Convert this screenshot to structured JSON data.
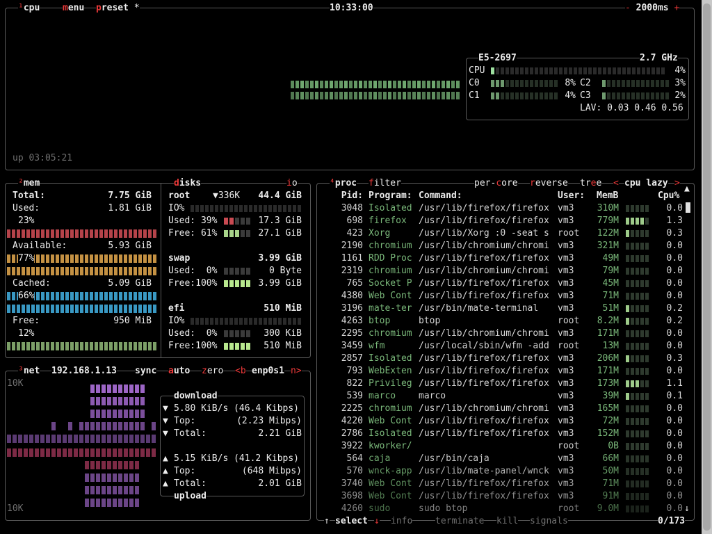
{
  "colors": {
    "background": "#000000",
    "border": "#5a5a5a",
    "accent_red": "#ee3a3a",
    "cpu_green": "#7ab87a",
    "mem_used": "#c94a52",
    "mem_available": "#d9a14a",
    "mem_cached": "#3fa8d8",
    "mem_free": "#8ab072",
    "net_download": "#a46ad0",
    "net_upload": "#c0406a"
  },
  "cpu_box": {
    "tab_num": "¹",
    "tab_label": "cpu",
    "menu_m": "m",
    "menu_rest": "enu",
    "preset_p": "p",
    "preset_rest": "reset",
    "star": "*",
    "clock": "10:33:00",
    "minus": "-",
    "interval": "2000ms",
    "plus": "+",
    "uptime": "up 03:05:21",
    "model": "E5-2697",
    "freq": "2.7 GHz",
    "total_label": "CPU",
    "total_pct": "4%",
    "total_value": 0.04,
    "cores": [
      {
        "name": "C0",
        "pct": "8%",
        "value": 0.08
      },
      {
        "name": "C1",
        "pct": "4%",
        "value": 0.04
      },
      {
        "name": "C2",
        "pct": "3%",
        "value": 0.03
      },
      {
        "name": "C3",
        "pct": "2%",
        "value": 0.02
      }
    ],
    "lav_label": "LAV:",
    "lav": "0.03 0.46 0.56"
  },
  "mem_box": {
    "tab_num": "²",
    "tab_label": "mem",
    "total_label": "Total:",
    "total": "7.75 GiB",
    "used_label": "Used:",
    "used": "1.81 GiB",
    "used_pct": "23%",
    "available_label": "Available:",
    "available": "5.93 GiB",
    "available_pct": "77%",
    "cached_label": "Cached:",
    "cached": "5.09 GiB",
    "cached_pct": "66%",
    "free_label": "Free:",
    "free": "950 MiB",
    "free_pct": "12%"
  },
  "disks_box": {
    "tab_d": "d",
    "tab_rest": "isks",
    "io_i": "i",
    "io_rest": "o",
    "root_label": "root",
    "root_io_speed": "▼336K",
    "root_size": "44.4 GiB",
    "io_label": "IO%",
    "root_used_label": "Used: 39%",
    "root_used": "17.3 GiB",
    "root_free_label": "Free: 61%",
    "root_free": "27.1 GiB",
    "swap_label": "swap",
    "swap_size": "3.99 GiB",
    "swap_used_label": "Used:  0%",
    "swap_used": "0 Byte",
    "swap_free_label": "Free:100%",
    "swap_free": "3.99 GiB",
    "efi_label": "efi",
    "efi_size": "510 MiB",
    "efi_io_label": "IO%",
    "efi_used_label": "Used:  0%",
    "efi_used": "300 KiB",
    "efi_free_label": "Free:100%",
    "efi_free": "510 MiB"
  },
  "net_box": {
    "tab_num": "³",
    "tab_label": "net",
    "ip": "192.168.1.13",
    "sync": "sync",
    "auto_a": "a",
    "auto_rest": "uto",
    "zero_z": "z",
    "zero_rest": "ero",
    "prev": "<b",
    "iface": "enp0s1",
    "next": "n>",
    "scale_top": "10K",
    "scale_bottom": "10K",
    "download_title": "download",
    "dl_rate": "5.80 KiB/s (46.4 Kibps)",
    "dl_top_label": "Top:",
    "dl_top": "(2.23 Mibps)",
    "dl_total_label": "Total:",
    "dl_total": "2.21 GiB",
    "ul_rate": "5.15 KiB/s (41.2 Kibps)",
    "ul_top_label": "Top:",
    "ul_top": "(648 Mibps)",
    "ul_total_label": "Total:",
    "ul_total": "2.01 GiB",
    "upload_title": "upload",
    "arrow_down": "▼",
    "arrow_up": "▲"
  },
  "proc_box": {
    "tab_num": "⁴",
    "tab_label": "proc",
    "filter_f": "f",
    "filter_rest": "ilter",
    "percore_a": "per-",
    "percore_c": "c",
    "percore_b": "ore",
    "reverse_r": "r",
    "reverse_rest": "everse",
    "tree_a": "tr",
    "tree_e": "e",
    "tree_b": "e",
    "sort_prev": "<",
    "sort": "cpu lazy",
    "sort_next": ">",
    "headers": {
      "pid": "Pid:",
      "program": "Program:",
      "command": "Command:",
      "user": "User:",
      "mem": "MemB",
      "cpu": "Cpu%"
    },
    "rows": [
      {
        "pid": "3048",
        "program": "Isolated",
        "command": "/usr/lib/firefox/firefox",
        "user": "vm3",
        "mem": "310M",
        "cpu": "0.0"
      },
      {
        "pid": "698",
        "program": "firefox",
        "command": "/usr/lib/firefox/firefox",
        "user": "vm3",
        "mem": "779M",
        "cpu": "1.3"
      },
      {
        "pid": "423",
        "program": "Xorg",
        "command": "/usr/lib/Xorg :0 -seat s",
        "user": "root",
        "mem": "122M",
        "cpu": "0.3"
      },
      {
        "pid": "2190",
        "program": "chromium",
        "command": "/usr/lib/chromium/chromi",
        "user": "vm3",
        "mem": "321M",
        "cpu": "0.0"
      },
      {
        "pid": "1161",
        "program": "RDD Proc",
        "command": "/usr/lib/firefox/firefox",
        "user": "vm3",
        "mem": "49M",
        "cpu": "0.0"
      },
      {
        "pid": "2319",
        "program": "chromium",
        "command": "/usr/lib/chromium/chromi",
        "user": "vm3",
        "mem": "79M",
        "cpu": "0.0"
      },
      {
        "pid": "765",
        "program": "Socket P",
        "command": "/usr/lib/firefox/firefox",
        "user": "vm3",
        "mem": "45M",
        "cpu": "0.0"
      },
      {
        "pid": "4380",
        "program": "Web Cont",
        "command": "/usr/lib/firefox/firefox",
        "user": "vm3",
        "mem": "71M",
        "cpu": "0.0"
      },
      {
        "pid": "3196",
        "program": "mate-ter",
        "command": "/usr/bin/mate-terminal",
        "user": "vm3",
        "mem": "51M",
        "cpu": "0.2"
      },
      {
        "pid": "4263",
        "program": "btop",
        "command": "btop",
        "user": "root",
        "mem": "8.2M",
        "cpu": "0.2"
      },
      {
        "pid": "2295",
        "program": "chromium",
        "command": "/usr/lib/chromium/chromi",
        "user": "vm3",
        "mem": "171M",
        "cpu": "0.0"
      },
      {
        "pid": "3459",
        "program": "wfm",
        "command": "/usr/local/sbin/wfm -add",
        "user": "root",
        "mem": "13M",
        "cpu": "0.0"
      },
      {
        "pid": "2857",
        "program": "Isolated",
        "command": "/usr/lib/firefox/firefox",
        "user": "vm3",
        "mem": "206M",
        "cpu": "0.3"
      },
      {
        "pid": "793",
        "program": "WebExten",
        "command": "/usr/lib/firefox/firefox",
        "user": "vm3",
        "mem": "171M",
        "cpu": "0.0"
      },
      {
        "pid": "822",
        "program": "Privileg",
        "command": "/usr/lib/firefox/firefox",
        "user": "vm3",
        "mem": "173M",
        "cpu": "1.1"
      },
      {
        "pid": "539",
        "program": "marco",
        "command": "marco",
        "user": "vm3",
        "mem": "39M",
        "cpu": "0.1"
      },
      {
        "pid": "2225",
        "program": "chromium",
        "command": "/usr/lib/chromium/chromi",
        "user": "vm3",
        "mem": "165M",
        "cpu": "0.0"
      },
      {
        "pid": "4220",
        "program": "Web Cont",
        "command": "/usr/lib/firefox/firefox",
        "user": "vm3",
        "mem": "72M",
        "cpu": "0.0"
      },
      {
        "pid": "2786",
        "program": "Isolated",
        "command": "/usr/lib/firefox/firefox",
        "user": "vm3",
        "mem": "152M",
        "cpu": "0.0"
      },
      {
        "pid": "3922",
        "program": "kworker/",
        "command": "",
        "user": "root",
        "mem": "0B",
        "cpu": "0.0"
      },
      {
        "pid": "564",
        "program": "caja",
        "command": "/usr/bin/caja",
        "user": "vm3",
        "mem": "66M",
        "cpu": "0.0"
      },
      {
        "pid": "570",
        "program": "wnck-app",
        "command": "/usr/lib/mate-panel/wnck",
        "user": "vm3",
        "mem": "50M",
        "cpu": "0.0"
      },
      {
        "pid": "3740",
        "program": "Web Cont",
        "command": "/usr/lib/firefox/firefox",
        "user": "vm3",
        "mem": "71M",
        "cpu": "0.0"
      },
      {
        "pid": "3698",
        "program": "Web Cont",
        "command": "/usr/lib/firefox/firefox",
        "user": "vm3",
        "mem": "91M",
        "cpu": "0.0"
      },
      {
        "pid": "4260",
        "program": "sudo",
        "command": "sudo btop",
        "user": "root",
        "mem": "9.0M",
        "cpu": "0.0"
      }
    ],
    "scroll_up": "▲",
    "scroll_down": "↓",
    "footer_up": "↑",
    "select_label": "select",
    "select_down": "↓",
    "info_label": "info",
    "terminate_label": "terminate",
    "kill_label": "kill",
    "signals_label": "signals",
    "count": "0/173"
  }
}
